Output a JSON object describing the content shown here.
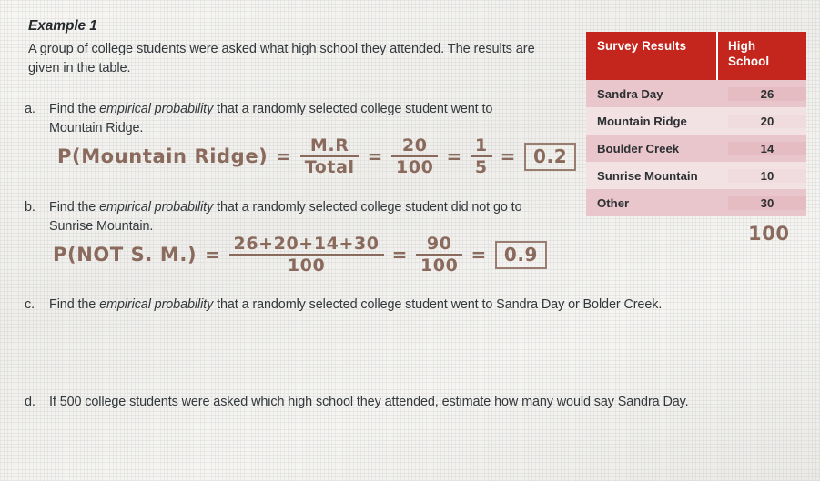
{
  "document": {
    "title": "Example 1",
    "intro": "A group of college students were asked what high school they attended.  The results are given in the table."
  },
  "questions": [
    {
      "letter": "a.",
      "text_before": "Find the ",
      "emphasis": "empirical probability",
      "text_after": " that a randomly selected college student went to Mountain Ridge."
    },
    {
      "letter": "b.",
      "text_before": "Find the ",
      "emphasis": "empirical probability",
      "text_after": " that a randomly selected college student did not go to Sunrise Mountain."
    },
    {
      "letter": "c.",
      "text_before": "Find the ",
      "emphasis": "empirical probability",
      "text_after": " that a randomly selected college student went to Sandra Day or Bolder Creek."
    },
    {
      "letter": "d.",
      "text_before": "If 500 college students were asked which high school they attended, estimate how many would say Sandra Day.",
      "emphasis": "",
      "text_after": ""
    }
  ],
  "table": {
    "header": {
      "label": "Survey Results",
      "value_line1": "High",
      "value_line2": "School"
    },
    "rows": [
      {
        "label": "Sandra Day",
        "value": "26"
      },
      {
        "label": "Mountain Ridge",
        "value": "20"
      },
      {
        "label": "Boulder Creek",
        "value": "14"
      },
      {
        "label": "Sunrise Mountain",
        "value": "10"
      },
      {
        "label": "Other",
        "value": "30"
      }
    ],
    "handwritten_total": "100",
    "header_color": "#c4261d",
    "row_shade_dark": "#e9c6cb",
    "row_shade_light": "#f3e2e4"
  },
  "handwriting": {
    "ink_color": "#8a6a5c",
    "part_a": {
      "lead": "P(Mountain Ridge)",
      "eq1": "=",
      "frac1_num": "M.R",
      "frac1_den": "Total",
      "eq2": "=",
      "frac2_num": "20",
      "frac2_den": "100",
      "eq3": "=",
      "frac3_num": "1",
      "frac3_den": "5",
      "eq4": "=",
      "answer": "0.2"
    },
    "part_b": {
      "lead": "P(NOT S. M.)",
      "eq1": "=",
      "frac1_num": "26+20+14+30",
      "frac1_den": "100",
      "eq2": "=",
      "frac2_num": "90",
      "frac2_den": "100",
      "eq3": "=",
      "answer": "0.9"
    }
  }
}
